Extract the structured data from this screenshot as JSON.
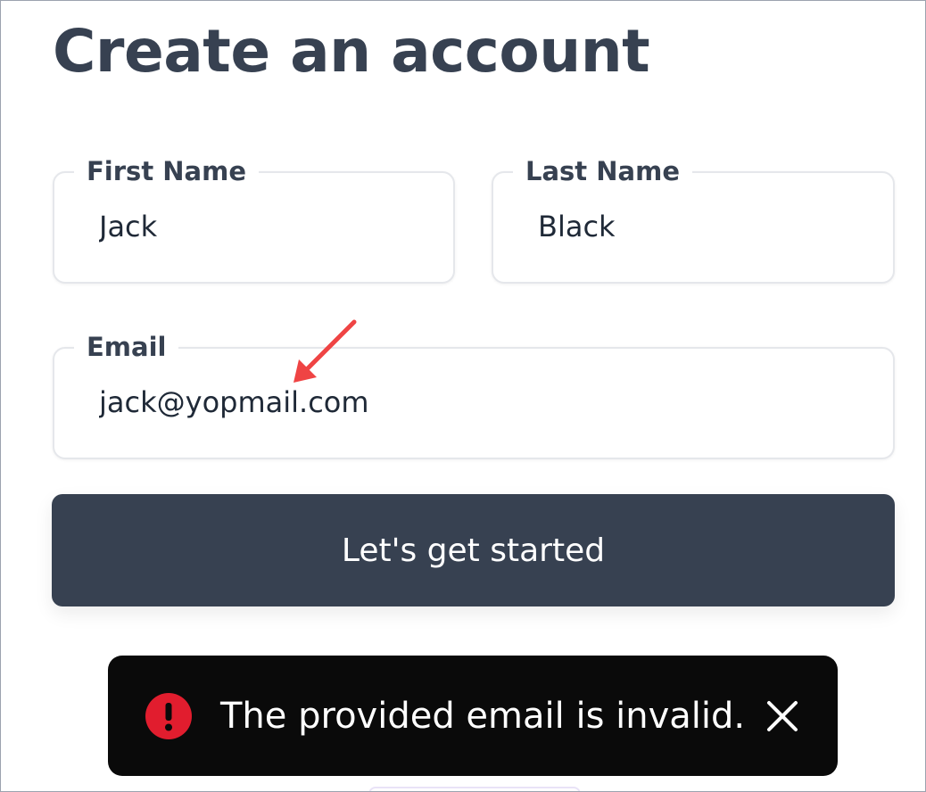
{
  "page": {
    "title": "Create an account"
  },
  "form": {
    "first_name": {
      "label": "First Name",
      "value": "Jack"
    },
    "last_name": {
      "label": "Last Name",
      "value": "Black"
    },
    "email": {
      "label": "Email",
      "value": "jack@yopmail.com"
    },
    "submit_label": "Let's get started"
  },
  "toast": {
    "message": "The provided email is invalid.",
    "icon": "error-icon",
    "close_icon": "close-icon"
  },
  "colors": {
    "primary_dark": "#374151",
    "error_red": "#e11d2e",
    "toast_bg": "#0a0a0a",
    "annotation_red": "#ef4444"
  }
}
